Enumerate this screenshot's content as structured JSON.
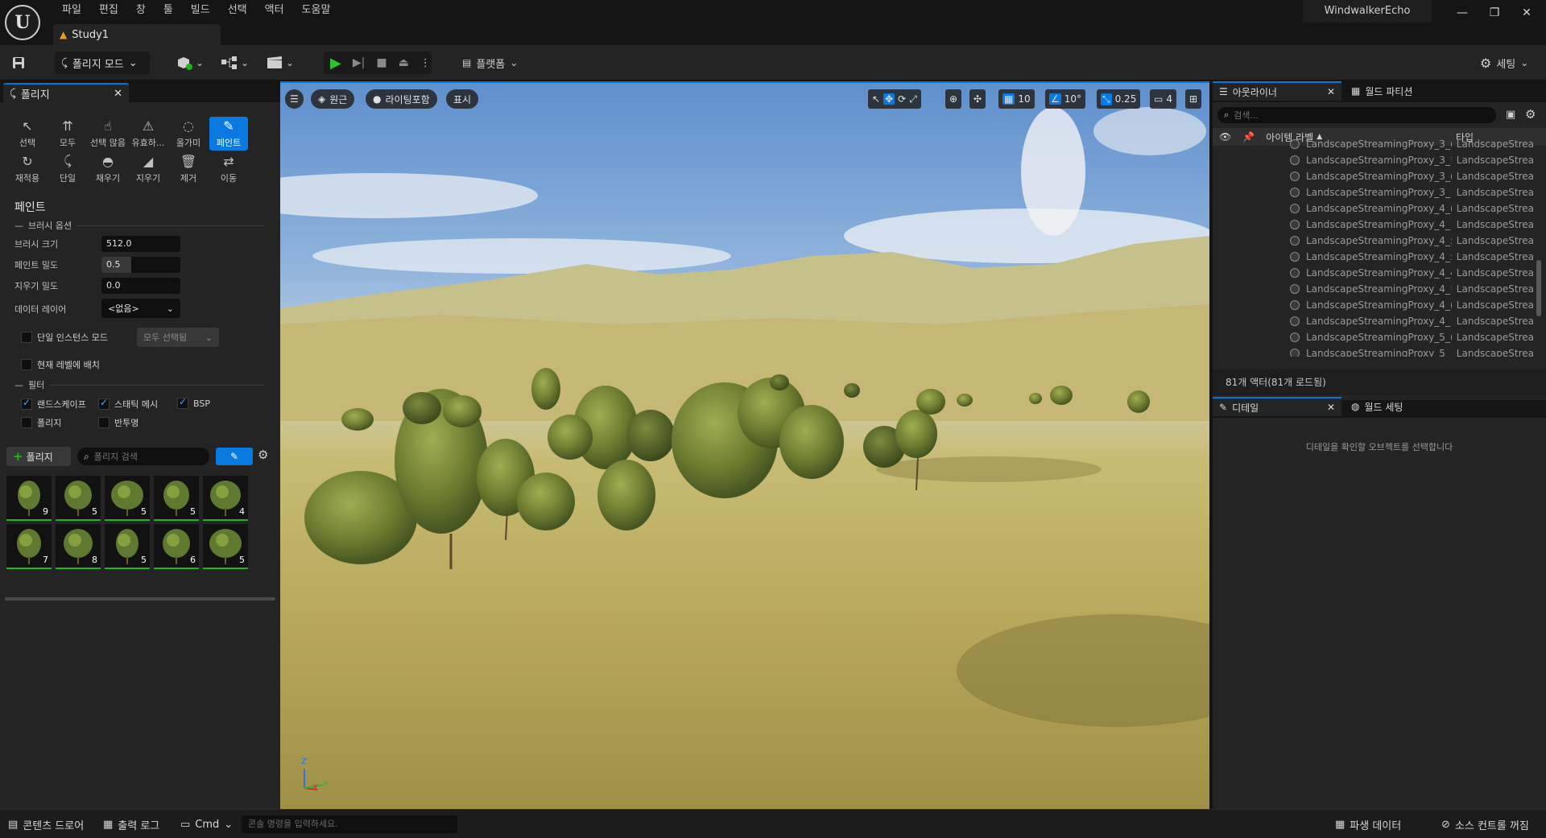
{
  "app": {
    "logo": "U",
    "menu": [
      "파일",
      "편집",
      "창",
      "툴",
      "빌드",
      "선택",
      "액터",
      "도움말"
    ],
    "document_tab": "Study1",
    "account": "WindwalkerEcho",
    "window_controls": [
      "minimize-icon",
      "restore-icon",
      "close-icon"
    ]
  },
  "toolbar": {
    "mode_label": "폴리지 모드",
    "platform_label": "플랫폼",
    "settings_label": "세팅"
  },
  "foliage_panel": {
    "tab_label": "폴리지",
    "tools_row1": [
      {
        "name": "select",
        "label": "선택",
        "icon": "cursor-icon"
      },
      {
        "name": "all",
        "label": "모두",
        "icon": "select-all-icon"
      },
      {
        "name": "deselect",
        "label": "선택 않음",
        "icon": "deselect-icon"
      },
      {
        "name": "invalid",
        "label": "유효하...",
        "icon": "invalid-select-icon"
      },
      {
        "name": "lasso",
        "label": "올가미",
        "icon": "lasso-icon"
      },
      {
        "name": "paint",
        "label": "페인트",
        "icon": "paint-brush-icon",
        "active": true
      }
    ],
    "tools_row2": [
      {
        "name": "reapply",
        "label": "재적용",
        "icon": "reapply-icon"
      },
      {
        "name": "single",
        "label": "단일",
        "icon": "single-icon"
      },
      {
        "name": "fill",
        "label": "채우기",
        "icon": "fill-icon"
      },
      {
        "name": "erase",
        "label": "지우기",
        "icon": "eraser-icon"
      },
      {
        "name": "remove",
        "label": "제거",
        "icon": "trash-icon"
      },
      {
        "name": "move",
        "label": "이동",
        "icon": "move-icon"
      }
    ],
    "section_title": "페인트",
    "brush_options_label": "브러시 옵션",
    "brush_size_label": "브러시 크기",
    "brush_size_value": "512.0",
    "paint_density_label": "페인트 밀도",
    "paint_density_value": "0.5",
    "paint_density_fraction": 0.38,
    "erase_density_label": "지우기 밀도",
    "erase_density_value": "0.0",
    "data_layer_label": "데이터 레이어",
    "data_layer_value": "<없음>",
    "single_instance_label": "단일 인스턴스 모드",
    "all_selected_label": "모두 선택됨",
    "current_level_label": "현재 레벨에 배치",
    "filter_label": "필터",
    "filters": [
      {
        "label": "랜드스케이프",
        "checked": true
      },
      {
        "label": "스태틱 메시",
        "checked": true
      },
      {
        "label": "BSP",
        "checked": true
      },
      {
        "label": "폴리지",
        "checked": false
      },
      {
        "label": "반투명",
        "checked": false
      }
    ],
    "add_foliage_label": "폴리지",
    "search_placeholder": "폴리지 검색",
    "thumb_counts": [
      "9",
      "5",
      "5",
      "5",
      "4",
      "7",
      "8",
      "5",
      "6",
      "5"
    ]
  },
  "viewport": {
    "perspective_label": "원근",
    "lighting_label": "라이팅포함",
    "show_label": "표시",
    "grid_snap": "10",
    "rotation_snap": "10°",
    "scale_snap": "0.25",
    "camera_speed": "4",
    "axis_labels": [
      "Z",
      "X",
      "Y"
    ]
  },
  "outliner": {
    "tab_label": "아웃라이너",
    "world_partition_label": "월드 파티션",
    "search_placeholder": "검색...",
    "col_label": "아이템 라벨",
    "col_type": "타입",
    "rows": [
      {
        "name": "LandscapeStreamingProxy_3_(",
        "type": "LandscapeStrea"
      },
      {
        "name": "LandscapeStreamingProxy_3_!",
        "type": "LandscapeStrea"
      },
      {
        "name": "LandscapeStreamingProxy_3_(",
        "type": "LandscapeStrea"
      },
      {
        "name": "LandscapeStreamingProxy_3_",
        "type": "LandscapeStrea"
      },
      {
        "name": "LandscapeStreamingProxy_4_(",
        "type": "LandscapeStrea"
      },
      {
        "name": "LandscapeStreamingProxy_4_",
        "type": "LandscapeStrea"
      },
      {
        "name": "LandscapeStreamingProxy_4_:",
        "type": "LandscapeStrea"
      },
      {
        "name": "LandscapeStreamingProxy_4_:",
        "type": "LandscapeStrea"
      },
      {
        "name": "LandscapeStreamingProxy_4_4",
        "type": "LandscapeStrea"
      },
      {
        "name": "LandscapeStreamingProxy_4_!",
        "type": "LandscapeStrea"
      },
      {
        "name": "LandscapeStreamingProxy_4_(",
        "type": "LandscapeStrea"
      },
      {
        "name": "LandscapeStreamingProxy_4_",
        "type": "LandscapeStrea"
      },
      {
        "name": "LandscapeStreamingProxy_5_(",
        "type": "LandscapeStrea"
      },
      {
        "name": "LandscapeStreamingProxy_5_",
        "type": "LandscapeStrea"
      }
    ],
    "status": "81개 액터(81개 로드됨)"
  },
  "details": {
    "tab_label": "디테일",
    "world_settings_label": "월드 세팅",
    "empty_message": "디테일을 확인할 오브젝트를 선택합니다"
  },
  "bottom_bar": {
    "content_drawer": "콘텐츠 드로어",
    "output_log": "출력 로그",
    "cmd": "Cmd",
    "console_placeholder": "콘솔 명령을 입력하세요.",
    "derived_data": "파생 데이터",
    "source_control": "소스 컨트롤 꺼짐"
  },
  "colors": {
    "accent": "#0a7ae0",
    "panel": "#242424",
    "background": "#151515"
  }
}
